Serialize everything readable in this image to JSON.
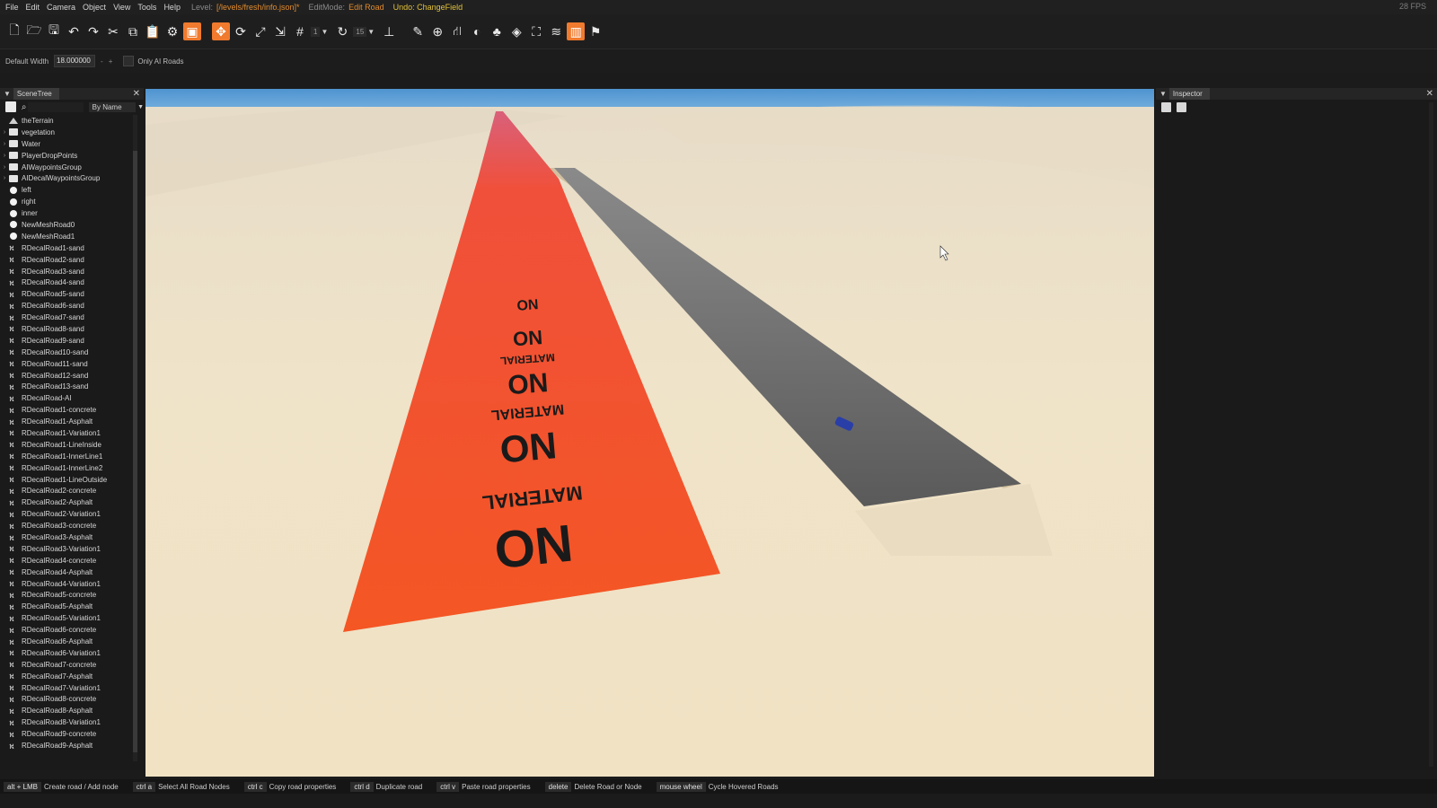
{
  "menubar": {
    "menus": [
      "File",
      "Edit",
      "Camera",
      "Object",
      "View",
      "Tools",
      "Help"
    ],
    "level_label": "Level:",
    "level_value": "[/levels/fresh/info.json]*",
    "editmode_label": "EditMode:",
    "editmode_value": "Edit Road",
    "undo_text": "Undo: ChangeField",
    "fps": "28 FPS"
  },
  "toolbar": {
    "grid_value": "1",
    "rotate_value": "15"
  },
  "options": {
    "default_width_label": "Default Width",
    "default_width_value": "18.000000",
    "minus": "-",
    "plus": "+",
    "only_ai_roads_label": "Only AI Roads"
  },
  "scenetree": {
    "title": "SceneTree",
    "sort_label": "By Name",
    "items": [
      {
        "label": "theTerrain",
        "icon": "terrain",
        "expander": ""
      },
      {
        "label": "vegetation",
        "icon": "folder",
        "expander": "›"
      },
      {
        "label": "Water",
        "icon": "folder",
        "expander": "›"
      },
      {
        "label": "PlayerDropPoints",
        "icon": "folder",
        "expander": "›"
      },
      {
        "label": "AIWaypointsGroup",
        "icon": "folder",
        "expander": "›"
      },
      {
        "label": "AIDecalWaypointsGroup",
        "icon": "folder",
        "expander": "›"
      },
      {
        "label": "left",
        "icon": "dot",
        "expander": ""
      },
      {
        "label": "right",
        "icon": "dot",
        "expander": ""
      },
      {
        "label": "inner",
        "icon": "dot",
        "expander": ""
      },
      {
        "label": "NewMeshRoad0",
        "icon": "dot",
        "expander": ""
      },
      {
        "label": "NewMeshRoad1",
        "icon": "dot",
        "expander": ""
      },
      {
        "label": "RDecalRoad1-sand",
        "icon": "road",
        "expander": ""
      },
      {
        "label": "RDecalRoad2-sand",
        "icon": "road",
        "expander": ""
      },
      {
        "label": "RDecalRoad3-sand",
        "icon": "road",
        "expander": ""
      },
      {
        "label": "RDecalRoad4-sand",
        "icon": "road",
        "expander": ""
      },
      {
        "label": "RDecalRoad5-sand",
        "icon": "road",
        "expander": ""
      },
      {
        "label": "RDecalRoad6-sand",
        "icon": "road",
        "expander": ""
      },
      {
        "label": "RDecalRoad7-sand",
        "icon": "road",
        "expander": ""
      },
      {
        "label": "RDecalRoad8-sand",
        "icon": "road",
        "expander": ""
      },
      {
        "label": "RDecalRoad9-sand",
        "icon": "road",
        "expander": ""
      },
      {
        "label": "RDecalRoad10-sand",
        "icon": "road",
        "expander": ""
      },
      {
        "label": "RDecalRoad11-sand",
        "icon": "road",
        "expander": ""
      },
      {
        "label": "RDecalRoad12-sand",
        "icon": "road",
        "expander": ""
      },
      {
        "label": "RDecalRoad13-sand",
        "icon": "road",
        "expander": ""
      },
      {
        "label": "RDecalRoad-AI",
        "icon": "road",
        "expander": ""
      },
      {
        "label": "RDecalRoad1-concrete",
        "icon": "road",
        "expander": ""
      },
      {
        "label": "RDecalRoad1-Asphalt",
        "icon": "road",
        "expander": ""
      },
      {
        "label": "RDecalRoad1-Variation1",
        "icon": "road",
        "expander": ""
      },
      {
        "label": "RDecalRoad1-LineInside",
        "icon": "road",
        "expander": ""
      },
      {
        "label": "RDecalRoad1-InnerLine1",
        "icon": "road",
        "expander": ""
      },
      {
        "label": "RDecalRoad1-InnerLine2",
        "icon": "road",
        "expander": ""
      },
      {
        "label": "RDecalRoad1-LineOutside",
        "icon": "road",
        "expander": ""
      },
      {
        "label": "RDecalRoad2-concrete",
        "icon": "road",
        "expander": ""
      },
      {
        "label": "RDecalRoad2-Asphalt",
        "icon": "road",
        "expander": ""
      },
      {
        "label": "RDecalRoad2-Variation1",
        "icon": "road",
        "expander": ""
      },
      {
        "label": "RDecalRoad3-concrete",
        "icon": "road",
        "expander": ""
      },
      {
        "label": "RDecalRoad3-Asphalt",
        "icon": "road",
        "expander": ""
      },
      {
        "label": "RDecalRoad3-Variation1",
        "icon": "road",
        "expander": ""
      },
      {
        "label": "RDecalRoad4-concrete",
        "icon": "road",
        "expander": ""
      },
      {
        "label": "RDecalRoad4-Asphalt",
        "icon": "road",
        "expander": ""
      },
      {
        "label": "RDecalRoad4-Variation1",
        "icon": "road",
        "expander": ""
      },
      {
        "label": "RDecalRoad5-concrete",
        "icon": "road",
        "expander": ""
      },
      {
        "label": "RDecalRoad5-Asphalt",
        "icon": "road",
        "expander": ""
      },
      {
        "label": "RDecalRoad5-Variation1",
        "icon": "road",
        "expander": ""
      },
      {
        "label": "RDecalRoad6-concrete",
        "icon": "road",
        "expander": ""
      },
      {
        "label": "RDecalRoad6-Asphalt",
        "icon": "road",
        "expander": ""
      },
      {
        "label": "RDecalRoad6-Variation1",
        "icon": "road",
        "expander": ""
      },
      {
        "label": "RDecalRoad7-concrete",
        "icon": "road",
        "expander": ""
      },
      {
        "label": "RDecalRoad7-Asphalt",
        "icon": "road",
        "expander": ""
      },
      {
        "label": "RDecalRoad7-Variation1",
        "icon": "road",
        "expander": ""
      },
      {
        "label": "RDecalRoad8-concrete",
        "icon": "road",
        "expander": ""
      },
      {
        "label": "RDecalRoad8-Asphalt",
        "icon": "road",
        "expander": ""
      },
      {
        "label": "RDecalRoad8-Variation1",
        "icon": "road",
        "expander": ""
      },
      {
        "label": "RDecalRoad9-concrete",
        "icon": "road",
        "expander": ""
      },
      {
        "label": "RDecalRoad9-Asphalt",
        "icon": "road",
        "expander": ""
      }
    ]
  },
  "viewport": {
    "decal_text_top": "MATERIAL",
    "decal_text_big": "NO"
  },
  "inspector": {
    "title": "Inspector"
  },
  "statusbar": {
    "hints": [
      {
        "key": "alt + LMB",
        "action": "Create road / Add node"
      },
      {
        "key": "ctrl a",
        "action": "Select All Road Nodes"
      },
      {
        "key": "ctrl c",
        "action": "Copy road properties"
      },
      {
        "key": "ctrl d",
        "action": "Duplicate road"
      },
      {
        "key": "ctrl v",
        "action": "Paste road properties"
      },
      {
        "key": "delete",
        "action": "Delete Road or Node"
      },
      {
        "key": "mouse wheel",
        "action": "Cycle Hovered Roads"
      }
    ]
  },
  "colors": {
    "accent": "#f07a2e",
    "level_text": "#e08a2c",
    "undo_text": "#e2c23a",
    "decal_red": "#f25a2a",
    "sand": "#efe2c6",
    "sky": "#5a9fd6",
    "asphalt": "#5c5c5c"
  }
}
